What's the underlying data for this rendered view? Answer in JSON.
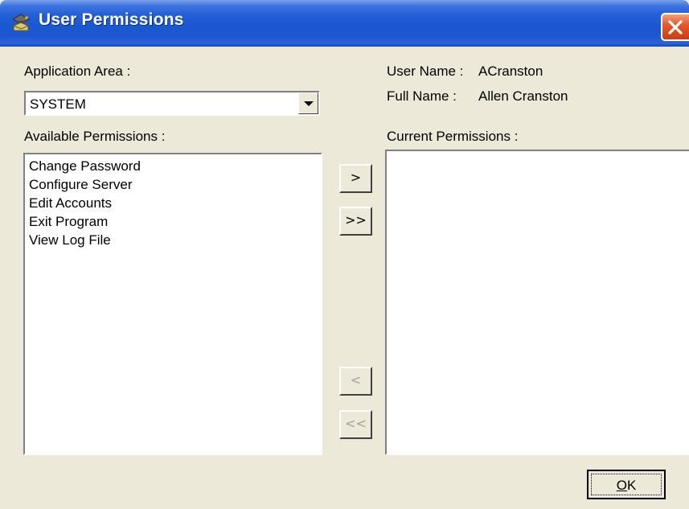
{
  "window": {
    "title": "User Permissions",
    "icon": "user-permissions-icon",
    "close_icon": "close-icon"
  },
  "application_area": {
    "label": "Application Area :",
    "selected_value": "SYSTEM"
  },
  "user": {
    "user_name_label": "User Name :",
    "user_name_value": "ACranston",
    "full_name_label": "Full Name :",
    "full_name_value": "Allen Cranston"
  },
  "available_permissions": {
    "label": "Available Permissions :",
    "items": [
      "Change Password",
      "Configure Server",
      "Edit Accounts",
      "Exit Program",
      "View Log File"
    ]
  },
  "current_permissions": {
    "label": "Current Permissions :",
    "items": []
  },
  "move_buttons": {
    "add_one": ">",
    "add_all": ">>",
    "remove_one": "<",
    "remove_all": "<<"
  },
  "ok_button": {
    "mnemonic": "O",
    "rest": "K"
  },
  "colors": {
    "titlebar": "#1d56cf",
    "dialog_bg": "#ece9d8",
    "close_button": "#e25a2e",
    "disabled_text": "#a0a0a0"
  }
}
